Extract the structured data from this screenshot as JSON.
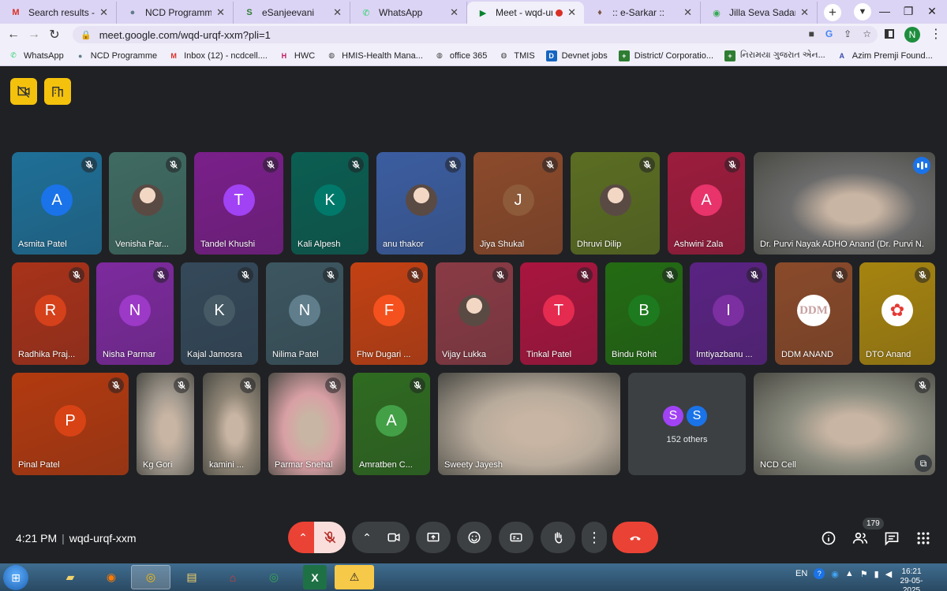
{
  "browser": {
    "tabs": [
      {
        "title": "Search results - ncd",
        "fav": "M",
        "favcolor": "#d93025"
      },
      {
        "title": "NCD Programme",
        "fav": "●",
        "favcolor": "#607d8b"
      },
      {
        "title": "eSanjeevani",
        "fav": "S",
        "favcolor": "#2e7d32"
      },
      {
        "title": "WhatsApp",
        "fav": "✆",
        "favcolor": "#25d366"
      },
      {
        "title": "Meet - wqd-urqf",
        "fav": "▶",
        "favcolor": "#00832d"
      },
      {
        "title": ":: e-Sarkar ::",
        "fav": "♦",
        "favcolor": "#795548"
      },
      {
        "title": "Jilla Seva Sadan - An",
        "fav": "◉",
        "favcolor": "#34a853"
      }
    ],
    "url": "meet.google.com/wqd-urqf-xxm?pli=1",
    "profile_initial": "N",
    "bookmarks": [
      {
        "label": "WhatsApp",
        "icon": "✆",
        "color": "#25d366"
      },
      {
        "label": "NCD Programme",
        "icon": "●",
        "color": "#607d8b"
      },
      {
        "label": "Inbox (12) - ncdcell....",
        "icon": "M",
        "color": "#d93025"
      },
      {
        "label": "HWC",
        "icon": "H",
        "color": "#c2185b"
      },
      {
        "label": "HMIS-Health Mana...",
        "icon": "◍",
        "color": "#424242"
      },
      {
        "label": "office 365",
        "icon": "◍",
        "color": "#424242"
      },
      {
        "label": "TMIS",
        "icon": "◍",
        "color": "#424242"
      },
      {
        "label": "Devnet jobs",
        "icon": "D",
        "color": "#1565c0"
      },
      {
        "label": "District/ Corporatio...",
        "icon": "+",
        "color": "#2e7d32"
      },
      {
        "label": "નિરામયા ગુજરાત એન...",
        "icon": "+",
        "color": "#2e7d32"
      },
      {
        "label": "Azim Premji Found...",
        "icon": "A",
        "color": "#3949ab"
      }
    ]
  },
  "meeting": {
    "time": "4:21 PM",
    "code": "wqd-urqf-xxm",
    "participant_count": "179",
    "others_label": "152 others",
    "others_initials": [
      "S",
      "S"
    ],
    "participants": [
      {
        "name": "Asmita Patel",
        "initial": "A",
        "avatar_color": "#1a73e8",
        "bg": "#1f6f97"
      },
      {
        "name": "Venisha Par...",
        "initial": "",
        "avatar_color": "photo",
        "bg": "#3f6b62"
      },
      {
        "name": "Tandel Khushi",
        "initial": "T",
        "avatar_color": "#a142f4",
        "bg": "#7a1f8a"
      },
      {
        "name": "Kali Alpesh",
        "initial": "K",
        "avatar_color": "#00796b",
        "bg": "#0b5e52"
      },
      {
        "name": "anu thakor",
        "initial": "",
        "avatar_color": "photo",
        "bg": "#3b5da0"
      },
      {
        "name": "Jiya Shukal",
        "initial": "J",
        "avatar_color": "#8d5a3a",
        "bg": "#8c4a2b"
      },
      {
        "name": "Dhruvi Dilip",
        "initial": "",
        "avatar_color": "photo",
        "bg": "#5b6e22"
      },
      {
        "name": "Ashwini Zala",
        "initial": "A",
        "avatar_color": "#e8336b",
        "bg": "#9d1c3d"
      },
      {
        "name": "Dr. Purvi Nayak ADHO Anand (Dr. Purvi N...",
        "initial": "",
        "avatar_color": "video",
        "bg": "#6b6b6b"
      },
      {
        "name": "Radhika Praj...",
        "initial": "R",
        "avatar_color": "#d5411b",
        "bg": "#a8321a"
      },
      {
        "name": "Nisha Parmar",
        "initial": "N",
        "avatar_color": "#9c39c7",
        "bg": "#7d2a9e"
      },
      {
        "name": "Kajal Jamosra",
        "initial": "K",
        "avatar_color": "#455a64",
        "bg": "#34495a"
      },
      {
        "name": "Nilima Patel",
        "initial": "N",
        "avatar_color": "#607d8b",
        "bg": "#3c5660"
      },
      {
        "name": "Fhw Dugari ...",
        "initial": "F",
        "avatar_color": "#f4511e",
        "bg": "#c34113"
      },
      {
        "name": "Vijay Lukka",
        "initial": "",
        "avatar_color": "photo",
        "bg": "#8a3b45"
      },
      {
        "name": "Tinkal Patel",
        "initial": "T",
        "avatar_color": "#e52b50",
        "bg": "#a9153f"
      },
      {
        "name": "Bindu Rohit",
        "initial": "B",
        "avatar_color": "#1e7a1e",
        "bg": "#236b13"
      },
      {
        "name": "Imtiyazbanu ...",
        "initial": "I",
        "avatar_color": "#7b2fa0",
        "bg": "#5a2383"
      },
      {
        "name": "DDM ANAND",
        "initial": "DDM",
        "avatar_color": "ddm",
        "bg": "#8a4a2a"
      },
      {
        "name": "DTO Anand",
        "initial": "",
        "avatar_color": "logo",
        "bg": "#a68410"
      },
      {
        "name": "Pinal Patel",
        "initial": "P",
        "avatar_color": "#d84315",
        "bg": "#b23a10"
      },
      {
        "name": "Kg Gori",
        "initial": "",
        "avatar_color": "video",
        "bg": "#a39a8f"
      },
      {
        "name": "kamini ...",
        "initial": "",
        "avatar_color": "video",
        "bg": "#8f8576"
      },
      {
        "name": "Parmar Snehal",
        "initial": "",
        "avatar_color": "video",
        "bg": "#d9a0a5"
      },
      {
        "name": "Amratben C...",
        "initial": "A",
        "avatar_color": "#43a047",
        "bg": "#2f6b21"
      },
      {
        "name": "Sweety Jayesh",
        "initial": "",
        "avatar_color": "video",
        "bg": "#b8ab9c"
      },
      {
        "name": "NCD Cell",
        "initial": "",
        "avatar_color": "video",
        "bg": "#8c8d80"
      }
    ]
  },
  "taskbar": {
    "lang": "EN",
    "time": "16:21",
    "date": "29-05-2025"
  },
  "colors": {
    "accent_blue": "#1a73e8",
    "hangup_red": "#ea4335",
    "control_dark": "#3c4043",
    "top_button_yellow": "#f4c20d"
  }
}
